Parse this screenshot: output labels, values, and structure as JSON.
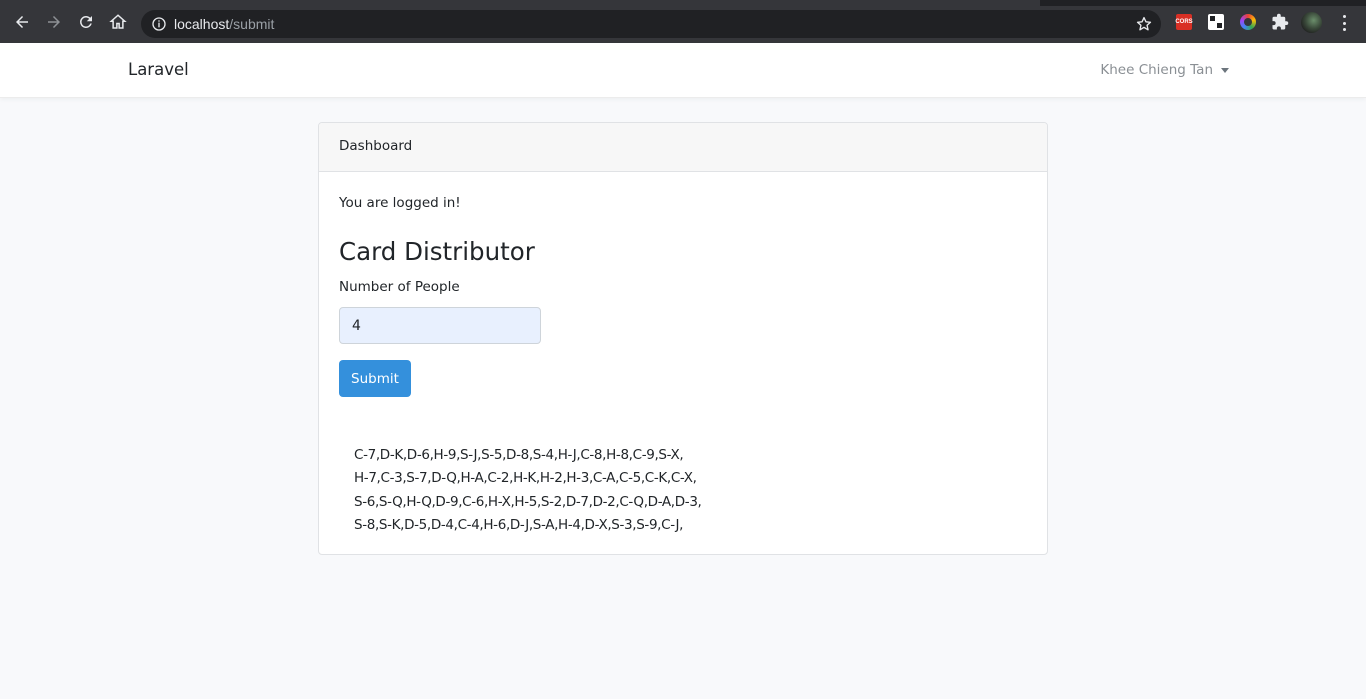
{
  "browser": {
    "url_host": "localhost",
    "url_path": "/submit",
    "extension_cors_label": "CORS"
  },
  "navbar": {
    "brand": "Laravel",
    "user_name": "Khee Chieng Tan"
  },
  "card": {
    "header": "Dashboard",
    "status_message": "You are logged in!",
    "form_title": "Card Distributor",
    "people_label": "Number of People",
    "people_value": "4",
    "submit_label": "Submit",
    "results": [
      "C-7,D-K,D-6,H-9,S-J,S-5,D-8,S-4,H-J,C-8,H-8,C-9,S-X,",
      "H-7,C-3,S-7,D-Q,H-A,C-2,H-K,H-2,H-3,C-A,C-5,C-K,C-X,",
      "S-6,S-Q,H-Q,D-9,C-6,H-X,H-5,S-2,D-7,D-2,C-Q,D-A,D-3,",
      "S-8,S-K,D-5,D-4,C-4,H-6,D-J,S-A,H-4,D-X,S-3,S-9,C-J,"
    ]
  }
}
